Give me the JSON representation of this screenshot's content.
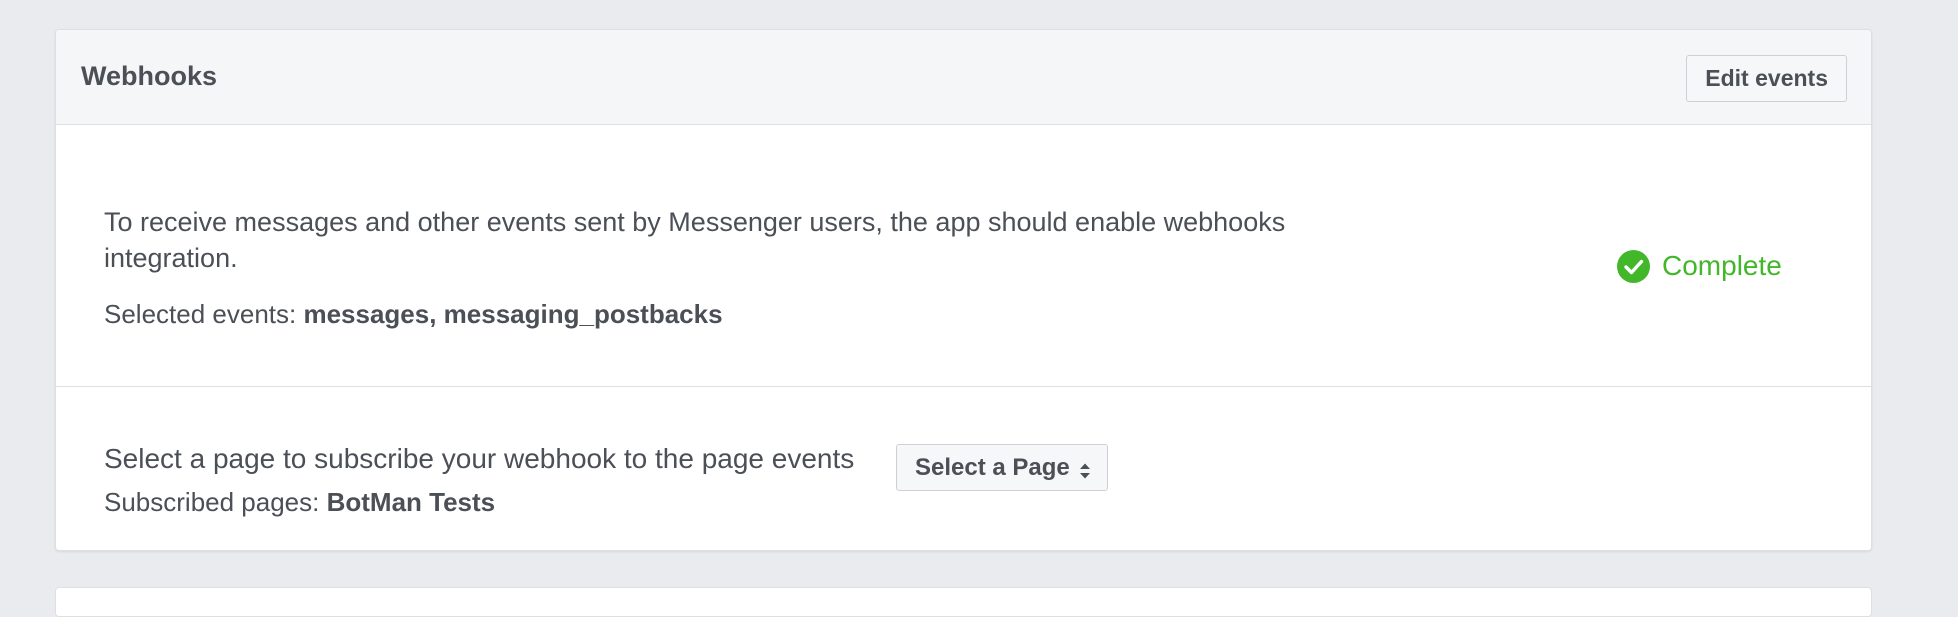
{
  "webhooks": {
    "title": "Webhooks",
    "edit_button_label": "Edit events",
    "description": "To receive messages and other events sent by Messenger users, the app should enable webhooks integration.",
    "selected_events_label": "Selected events: ",
    "selected_events_value": "messages, messaging_postbacks",
    "status": {
      "label": "Complete",
      "icon": "check-circle-icon",
      "color": "#42b72a"
    },
    "page_subscription": {
      "prompt": "Select a page to subscribe your webhook to the page events",
      "select_label": "Select a Page",
      "select_icon": "up-down-chevron-icon",
      "subscribed_label": "Subscribed pages: ",
      "subscribed_value": "BotMan Tests"
    }
  },
  "colors": {
    "page_background": "#e9ebee",
    "panel_header_background": "#f5f6f7",
    "text": "#4b4f56",
    "success": "#42b72a"
  }
}
